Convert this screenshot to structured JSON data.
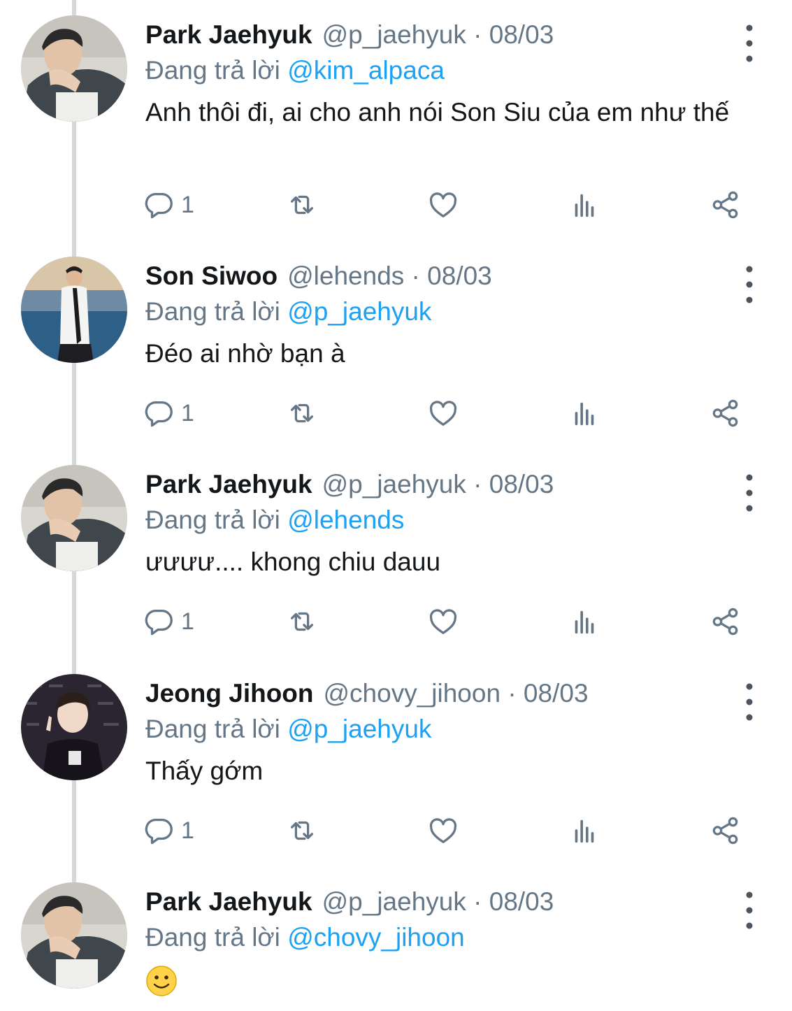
{
  "colors": {
    "accent": "#1da1f2",
    "secondary": "#657786",
    "thread_line": "#d5d8db"
  },
  "icons": {
    "more": "more-vertical-icon",
    "reply": "reply-icon",
    "retweet": "retweet-icon",
    "like": "heart-icon",
    "views": "analytics-icon",
    "share": "share-icon"
  },
  "tweets": [
    {
      "name": "Park Jaehyuk",
      "meta": "@p_jaehyuk · 08/03",
      "reply_prefix": "Đang trả lời",
      "reply_to": "@kim_alpaca",
      "text": "Anh thôi đi, ai cho anh nói Son Siu của em như thế",
      "reply_count": "1"
    },
    {
      "name": "Son Siwoo",
      "meta": "@lehends · 08/03",
      "reply_prefix": "Đang trả lời",
      "reply_to": "@p_jaehyuk",
      "text": "Đéo ai nhờ bạn à",
      "reply_count": "1"
    },
    {
      "name": "Park Jaehyuk",
      "meta": "@p_jaehyuk · 08/03",
      "reply_prefix": "Đang trả lời",
      "reply_to": "@lehends",
      "text": "ưưưư.... khong chiu dauu",
      "reply_count": "1"
    },
    {
      "name": "Jeong Jihoon",
      "meta": "@chovy_jihoon · 08/03",
      "reply_prefix": "Đang trả lời",
      "reply_to": "@p_jaehyuk",
      "text": "Thấy gớm",
      "reply_count": "1"
    },
    {
      "name": "Park Jaehyuk",
      "meta": "@p_jaehyuk · 08/03",
      "reply_prefix": "Đang trả lời",
      "reply_to": "@chovy_jihoon",
      "text": "",
      "emoji": "slightly-smiling-face-emoji"
    }
  ]
}
